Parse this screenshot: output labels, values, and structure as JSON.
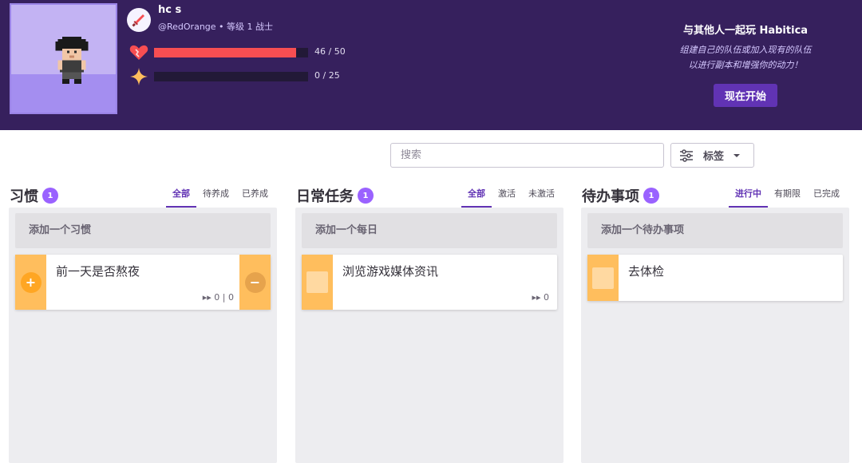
{
  "colors": {
    "header_bg": "#36205d",
    "accent": "#6133b4",
    "badge": "#9a62ff",
    "health": "#f74e52",
    "experience": "#ffbe5d",
    "task_yellow": "#ffbe5d"
  },
  "header": {
    "username": "hc s",
    "handle": "@RedOrange",
    "separator": "•",
    "level_class": "等级 1 战士",
    "class_icon": "sword-icon",
    "health": {
      "icon": "heart-icon",
      "text": "46 / 50",
      "fraction": 0.92
    },
    "experience": {
      "icon": "star-icon",
      "text": "0 / 25",
      "fraction": 0
    },
    "party": {
      "title": "与其他人一起玩 Habitica",
      "description_line1": "组建自己的队伍或加入现有的队伍",
      "description_line2": "以进行副本和增强你的动力！",
      "button": "现在开始"
    }
  },
  "toolbar": {
    "search_placeholder": "搜索",
    "tag_icon": "filter-sliders-icon",
    "tag_label": "标签"
  },
  "columns": {
    "habits": {
      "title": "习惯",
      "count": "1",
      "filters": [
        "全部",
        "待养成",
        "已养成"
      ],
      "active_filter": 0,
      "add_label": "添加一个习惯",
      "tasks": [
        {
          "text": "前一天是否熬夜",
          "plus": "+",
          "minus": "−",
          "counter": "0 | 0"
        }
      ]
    },
    "dailies": {
      "title": "日常任务",
      "count": "1",
      "filters": [
        "全部",
        "激活",
        "未激活"
      ],
      "active_filter": 0,
      "add_label": "添加一个每日",
      "tasks": [
        {
          "text": "浏览游戏媒体资讯",
          "streak": "0"
        }
      ]
    },
    "todos": {
      "title": "待办事项",
      "count": "1",
      "filters": [
        "进行中",
        "有期限",
        "已完成"
      ],
      "active_filter": 0,
      "add_label": "添加一个待办事项",
      "tasks": [
        {
          "text": "去体检"
        }
      ]
    }
  }
}
